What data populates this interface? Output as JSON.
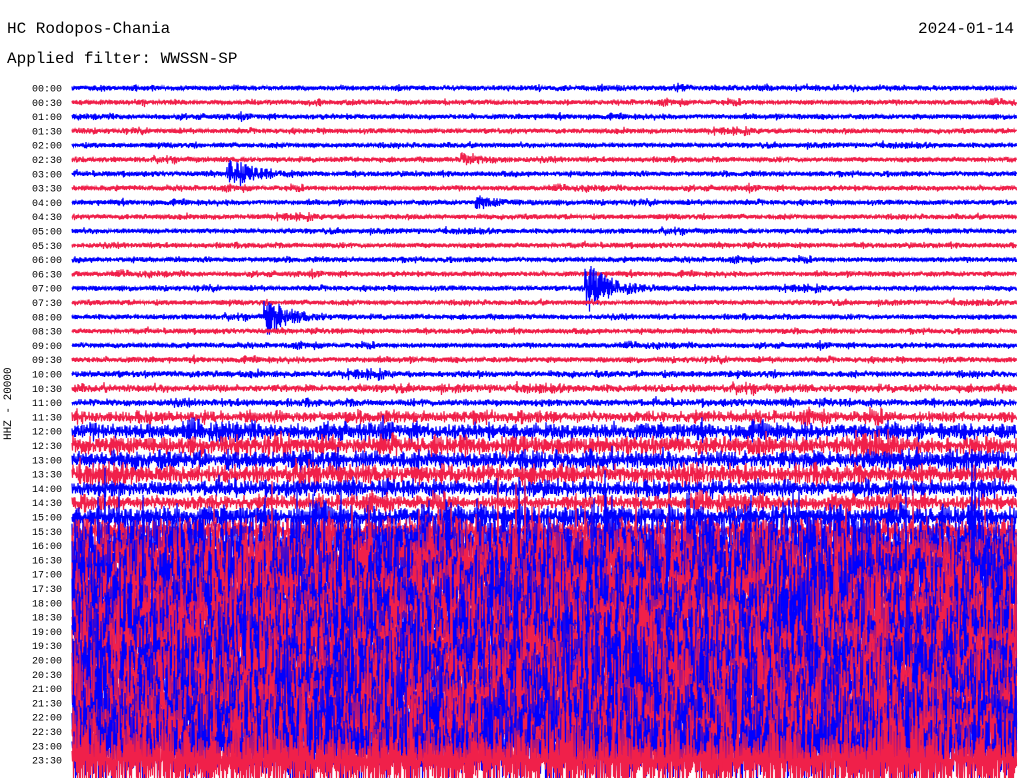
{
  "header": {
    "station": "HC Rodopos-Chania",
    "date": "2024-01-14",
    "filter": "Applied filter: WWSSN-SP"
  },
  "chart_data": {
    "type": "line",
    "title": "HC Rodopos-Chania",
    "ylabel": "HHZ - 20000",
    "row_minutes": 30,
    "colors": [
      "#0000ff",
      "#f0204a"
    ],
    "row_labels": [
      "00:00",
      "00:30",
      "01:00",
      "01:30",
      "02:00",
      "02:30",
      "03:00",
      "03:30",
      "04:00",
      "04:30",
      "05:00",
      "05:30",
      "06:00",
      "06:30",
      "07:00",
      "07:30",
      "08:00",
      "08:30",
      "09:00",
      "09:30",
      "10:00",
      "10:30",
      "11:00",
      "11:30",
      "12:00",
      "12:30",
      "13:00",
      "13:30",
      "14:00",
      "14:30",
      "15:00",
      "15:30",
      "16:00",
      "16:30",
      "17:00",
      "17:30",
      "18:00",
      "18:30",
      "19:00",
      "19:30",
      "20:00",
      "20:30",
      "21:00",
      "21:30",
      "22:00",
      "22:30",
      "23:00",
      "23:30"
    ],
    "row_amplitude": [
      1,
      1,
      1,
      1,
      1,
      1,
      1,
      1,
      1,
      1,
      1,
      1,
      1,
      1,
      1,
      1,
      1,
      1,
      1,
      1.1,
      1.3,
      1.5,
      1.4,
      2.2,
      3,
      3.5,
      3.5,
      3.5,
      3,
      2.8,
      4,
      5,
      12,
      13,
      13,
      12,
      13,
      13,
      13,
      13,
      13,
      13,
      14,
      14,
      14,
      14,
      14,
      14
    ],
    "events": [
      {
        "row": 5,
        "minute": 12.5,
        "amp": 2.5
      },
      {
        "row": 6,
        "minute": 5.1,
        "amp": 6
      },
      {
        "row": 8,
        "minute": 13,
        "amp": 2
      },
      {
        "row": 14,
        "minute": 16.5,
        "amp": 10
      },
      {
        "row": 16,
        "minute": 6.3,
        "amp": 7
      }
    ]
  }
}
